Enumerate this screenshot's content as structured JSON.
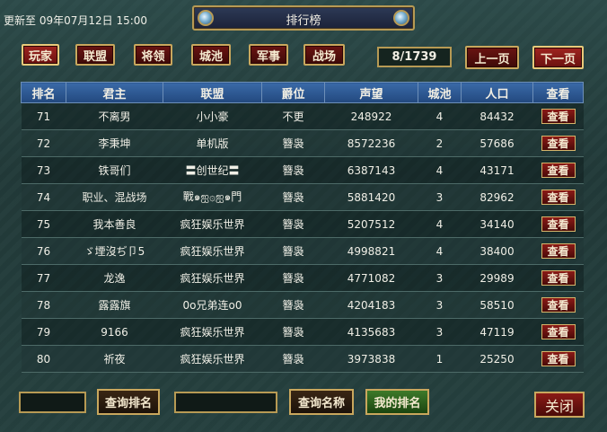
{
  "update_text": "更新至 09年07月12日 15:00",
  "window_title": "排行榜",
  "tabs": [
    "玩家",
    "联盟",
    "将领",
    "城池",
    "军事",
    "战场"
  ],
  "page_indicator": "8/1739",
  "prev_page": "上一页",
  "next_page": "下一页",
  "columns": [
    "排名",
    "君主",
    "联盟",
    "爵位",
    "声望",
    "城池",
    "人口",
    "查看"
  ],
  "rows": [
    {
      "rank": "71",
      "lord": "不离男",
      "alliance": "小小豪",
      "title": "不更",
      "prestige": "248922",
      "cities": "4",
      "population": "84432",
      "view": "查看"
    },
    {
      "rank": "72",
      "lord": "李秉坤",
      "alliance": "单机版",
      "title": "簪袅",
      "prestige": "8572236",
      "cities": "2",
      "population": "57686",
      "view": "查看"
    },
    {
      "rank": "73",
      "lord": "铁哥们",
      "alliance": "〓创世纪〓",
      "title": "簪袅",
      "prestige": "6387143",
      "cities": "4",
      "population": "43171",
      "view": "查看"
    },
    {
      "rank": "74",
      "lord": "职业、混战场",
      "alliance": "戰๑ஐ۞ஐ๑門",
      "title": "簪袅",
      "prestige": "5881420",
      "cities": "3",
      "population": "82962",
      "view": "查看"
    },
    {
      "rank": "75",
      "lord": "我本善良",
      "alliance": "疯狂娱乐世界",
      "title": "簪袅",
      "prestige": "5207512",
      "cities": "4",
      "population": "34140",
      "view": "查看"
    },
    {
      "rank": "76",
      "lord": "ゞ堙沒ぢ卩5",
      "alliance": "疯狂娱乐世界",
      "title": "簪袅",
      "prestige": "4998821",
      "cities": "4",
      "population": "38400",
      "view": "查看"
    },
    {
      "rank": "77",
      "lord": "龙逸",
      "alliance": "疯狂娱乐世界",
      "title": "簪袅",
      "prestige": "4771082",
      "cities": "3",
      "population": "29989",
      "view": "查看"
    },
    {
      "rank": "78",
      "lord": "露露旗",
      "alliance": "0o兄弟连o0",
      "title": "簪袅",
      "prestige": "4204183",
      "cities": "3",
      "population": "58510",
      "view": "查看"
    },
    {
      "rank": "79",
      "lord": "9166",
      "alliance": "疯狂娱乐世界",
      "title": "簪袅",
      "prestige": "4135683",
      "cities": "3",
      "population": "47119",
      "view": "查看"
    },
    {
      "rank": "80",
      "lord": "祈夜",
      "alliance": "疯狂娱乐世界",
      "title": "簪袅",
      "prestige": "3973838",
      "cities": "1",
      "population": "25250",
      "view": "查看"
    }
  ],
  "search_rank_btn": "查询排名",
  "search_name_btn": "查询名称",
  "my_rank_btn": "我的排名",
  "close_btn": "关闭",
  "colors": {
    "accent_gold": "#c9a75d",
    "button_red": "#6a1412",
    "header_blue": "#2f5c96",
    "my_rank_green": "#3d7a2a"
  }
}
